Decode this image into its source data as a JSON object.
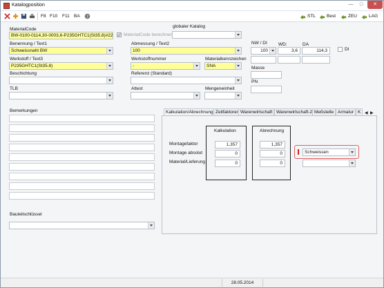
{
  "window": {
    "title": "Katalogposition"
  },
  "toolbar": {
    "f8": "F8",
    "f10": "F10",
    "f11": "F11",
    "ba": "BA",
    "right": [
      {
        "label": "STL",
        "icon": "arrow-icon"
      },
      {
        "label": "Best",
        "icon": "arrow-icon"
      },
      {
        "label": "ZEU",
        "icon": "arrow-icon"
      },
      {
        "label": "LAG",
        "icon": "arrow-icon"
      }
    ]
  },
  "form": {
    "materialcode": {
      "label": "MaterialCode",
      "value": "BW-0100-0114,30-0003,6-P235GHTC1(St35.8)#22"
    },
    "materialcode_berechnen": {
      "label": "MaterialCode berechnen",
      "checked": true
    },
    "globaler_katalog": {
      "label": "globaler Katalog",
      "value": ""
    },
    "benennung": {
      "label": "Benennung / Text1",
      "value": "Schweissnaht BW"
    },
    "abmessung": {
      "label": "Abmessung / Text2",
      "value": "100"
    },
    "werkstoff": {
      "label": "Werkstoff / Text3",
      "value": "P235GHTC1(St35.8)"
    },
    "werkstoffnummer": {
      "label": "Werkstoffnummer",
      "value": "-"
    },
    "materialkennzeichen": {
      "label": "Materialkennzeichen",
      "value": "SNA"
    },
    "beschichtung": {
      "label": "Beschichtung",
      "value": ""
    },
    "referenz": {
      "label": "Referenz (Standard)",
      "value": ""
    },
    "tlb": {
      "label": "TLB",
      "value": ""
    },
    "attest": {
      "label": "Attest",
      "value": ""
    },
    "mengeneinheit": {
      "label": "Mengeneinheit",
      "value": ""
    },
    "nw_di": {
      "label": "NW / DI",
      "value": "100"
    },
    "wd": {
      "label": "WD:",
      "value": "3,6"
    },
    "da": {
      "label": "DA",
      "value": "114,3"
    },
    "di_check": {
      "label": "DI",
      "checked": false
    },
    "masse": {
      "label": "Masse",
      "value": ""
    },
    "pn": {
      "label": "PN",
      "value": ""
    },
    "bemerkungen": {
      "label": "Bemerkungen"
    },
    "bauteilschluessel": {
      "label": "Bauteilschlüssel",
      "value": ""
    }
  },
  "tabs": [
    "Kalkulation/Abrechnung",
    "Zeitfaktoren",
    "Warenwirtschaft",
    "Warenwirtschaft-2",
    "Meßstelle",
    "Armatur",
    "K"
  ],
  "kalkulation": {
    "col_kalkulation": "Kalkulation",
    "col_abrechnung": "Abrechnung",
    "rows": [
      {
        "label": "Montagefaktor",
        "kalk": "1,357",
        "abr": "1,357"
      },
      {
        "label": "Montage absolut",
        "kalk": "0",
        "abr": "0"
      },
      {
        "label": "Material/Lieferung",
        "kalk": "0",
        "abr": "0"
      }
    ],
    "schweissen": "Schweissen",
    "second_select": ""
  },
  "status": {
    "date": "28.05.2014"
  }
}
